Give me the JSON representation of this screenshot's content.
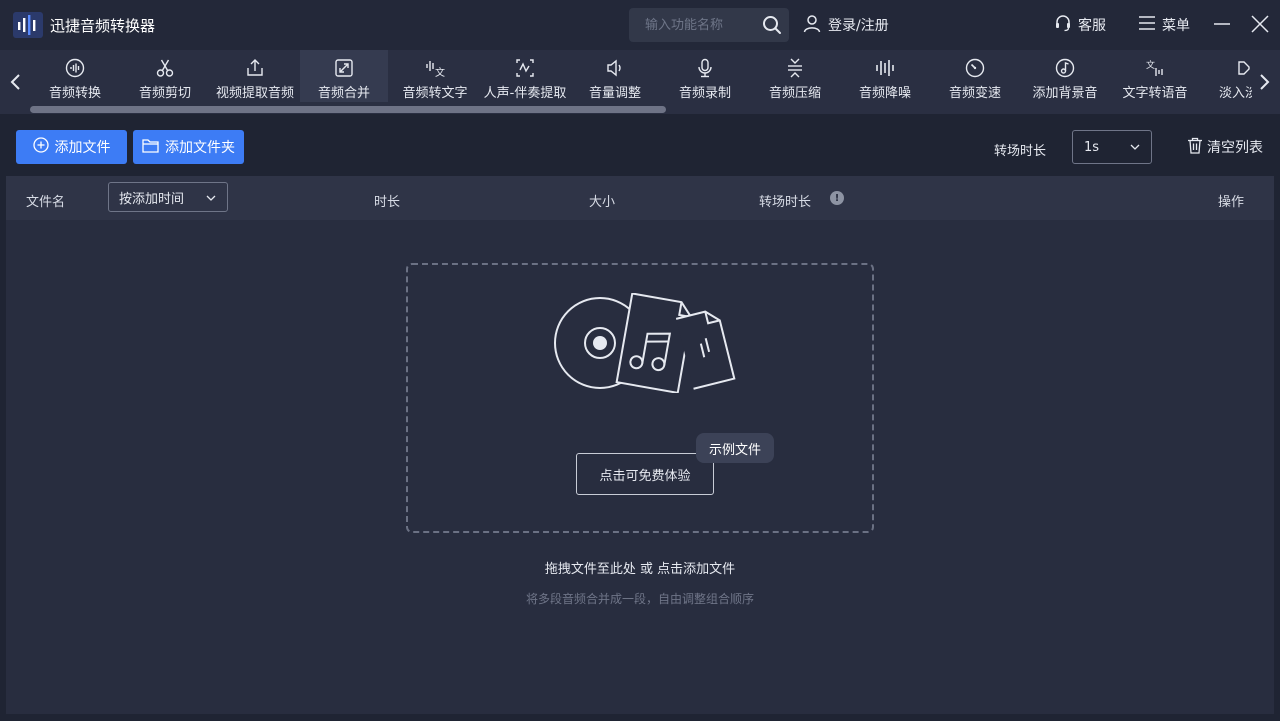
{
  "app": {
    "title": "迅捷音频转换器"
  },
  "header": {
    "search_placeholder": "输入功能名称",
    "login_label": "登录/注册",
    "service_label": "客服",
    "menu_label": "菜单"
  },
  "tabs": [
    {
      "label": "音频转换",
      "icon": "waveform-circle-icon"
    },
    {
      "label": "音频剪切",
      "icon": "scissors-icon"
    },
    {
      "label": "视频提取音频",
      "icon": "upload-box-icon"
    },
    {
      "label": "音频合并",
      "icon": "merge-arrows-icon",
      "active": true
    },
    {
      "label": "音频转文字",
      "icon": "audio-to-text-icon"
    },
    {
      "label": "人声-伴奏提取",
      "icon": "vocal-extract-icon"
    },
    {
      "label": "音量调整",
      "icon": "speaker-icon"
    },
    {
      "label": "音频录制",
      "icon": "microphone-icon"
    },
    {
      "label": "音频压缩",
      "icon": "compress-icon"
    },
    {
      "label": "音频降噪",
      "icon": "equalizer-icon"
    },
    {
      "label": "音频变速",
      "icon": "speedometer-icon"
    },
    {
      "label": "添加背景音",
      "icon": "music-note-circle-icon"
    },
    {
      "label": "文字转语音",
      "icon": "text-to-speech-icon"
    },
    {
      "label": "淡入淡出",
      "icon": "fade-icon"
    }
  ],
  "toolbar": {
    "add_file_label": "添加文件",
    "add_folder_label": "添加文件夹",
    "transition_label": "转场时长",
    "transition_value": "1s",
    "clear_list_label": "清空列表"
  },
  "table": {
    "col_filename": "文件名",
    "sort_value": "按添加时间",
    "col_duration": "时长",
    "col_size": "大小",
    "col_transition": "转场时长",
    "col_actions": "操作"
  },
  "dropzone": {
    "trial_button": "点击可免费体验",
    "sample_tag": "示例文件",
    "hint": "拖拽文件至此处 或 点击添加文件",
    "subhint": "将多段音频合并成一段，自由调整组合顺序"
  },
  "colors": {
    "accent": "#3d7cf5",
    "background": "#1f2433",
    "panel": "#282d3f"
  }
}
